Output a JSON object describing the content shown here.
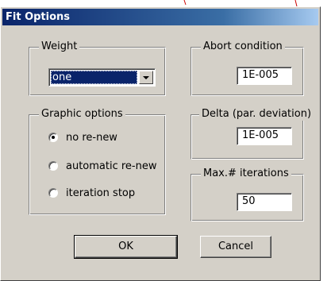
{
  "dialog": {
    "title": "Fit Options"
  },
  "weight": {
    "label": "Weight",
    "selected": "one"
  },
  "graphic": {
    "label": "Graphic options",
    "options": [
      {
        "label": "no re-new",
        "checked": true
      },
      {
        "label": "automatic re-new",
        "checked": false
      },
      {
        "label": "iteration stop",
        "checked": false
      }
    ]
  },
  "abort": {
    "label": "Abort condition",
    "value": "1E-005"
  },
  "delta": {
    "label": "Delta (par. deviation)",
    "value": "1E-005"
  },
  "max_iter": {
    "label": "Max.# iterations",
    "value": "50"
  },
  "buttons": {
    "ok": "OK",
    "cancel": "Cancel"
  },
  "colors": {
    "title_bar": "#0a246a",
    "face": "#d4d0c8",
    "selection": "#0a246a"
  }
}
